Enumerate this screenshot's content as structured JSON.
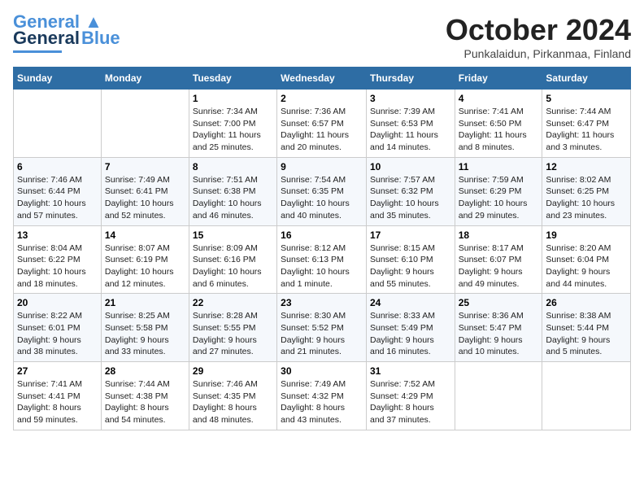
{
  "header": {
    "logo_main": "General",
    "logo_accent": "Blue",
    "month_title": "October 2024",
    "subtitle": "Punkalaidun, Pirkanmaa, Finland"
  },
  "weekdays": [
    "Sunday",
    "Monday",
    "Tuesday",
    "Wednesday",
    "Thursday",
    "Friday",
    "Saturday"
  ],
  "weeks": [
    [
      {
        "day": "",
        "info": ""
      },
      {
        "day": "",
        "info": ""
      },
      {
        "day": "1",
        "info": "Sunrise: 7:34 AM\nSunset: 7:00 PM\nDaylight: 11 hours\nand 25 minutes."
      },
      {
        "day": "2",
        "info": "Sunrise: 7:36 AM\nSunset: 6:57 PM\nDaylight: 11 hours\nand 20 minutes."
      },
      {
        "day": "3",
        "info": "Sunrise: 7:39 AM\nSunset: 6:53 PM\nDaylight: 11 hours\nand 14 minutes."
      },
      {
        "day": "4",
        "info": "Sunrise: 7:41 AM\nSunset: 6:50 PM\nDaylight: 11 hours\nand 8 minutes."
      },
      {
        "day": "5",
        "info": "Sunrise: 7:44 AM\nSunset: 6:47 PM\nDaylight: 11 hours\nand 3 minutes."
      }
    ],
    [
      {
        "day": "6",
        "info": "Sunrise: 7:46 AM\nSunset: 6:44 PM\nDaylight: 10 hours\nand 57 minutes."
      },
      {
        "day": "7",
        "info": "Sunrise: 7:49 AM\nSunset: 6:41 PM\nDaylight: 10 hours\nand 52 minutes."
      },
      {
        "day": "8",
        "info": "Sunrise: 7:51 AM\nSunset: 6:38 PM\nDaylight: 10 hours\nand 46 minutes."
      },
      {
        "day": "9",
        "info": "Sunrise: 7:54 AM\nSunset: 6:35 PM\nDaylight: 10 hours\nand 40 minutes."
      },
      {
        "day": "10",
        "info": "Sunrise: 7:57 AM\nSunset: 6:32 PM\nDaylight: 10 hours\nand 35 minutes."
      },
      {
        "day": "11",
        "info": "Sunrise: 7:59 AM\nSunset: 6:29 PM\nDaylight: 10 hours\nand 29 minutes."
      },
      {
        "day": "12",
        "info": "Sunrise: 8:02 AM\nSunset: 6:25 PM\nDaylight: 10 hours\nand 23 minutes."
      }
    ],
    [
      {
        "day": "13",
        "info": "Sunrise: 8:04 AM\nSunset: 6:22 PM\nDaylight: 10 hours\nand 18 minutes."
      },
      {
        "day": "14",
        "info": "Sunrise: 8:07 AM\nSunset: 6:19 PM\nDaylight: 10 hours\nand 12 minutes."
      },
      {
        "day": "15",
        "info": "Sunrise: 8:09 AM\nSunset: 6:16 PM\nDaylight: 10 hours\nand 6 minutes."
      },
      {
        "day": "16",
        "info": "Sunrise: 8:12 AM\nSunset: 6:13 PM\nDaylight: 10 hours\nand 1 minute."
      },
      {
        "day": "17",
        "info": "Sunrise: 8:15 AM\nSunset: 6:10 PM\nDaylight: 9 hours\nand 55 minutes."
      },
      {
        "day": "18",
        "info": "Sunrise: 8:17 AM\nSunset: 6:07 PM\nDaylight: 9 hours\nand 49 minutes."
      },
      {
        "day": "19",
        "info": "Sunrise: 8:20 AM\nSunset: 6:04 PM\nDaylight: 9 hours\nand 44 minutes."
      }
    ],
    [
      {
        "day": "20",
        "info": "Sunrise: 8:22 AM\nSunset: 6:01 PM\nDaylight: 9 hours\nand 38 minutes."
      },
      {
        "day": "21",
        "info": "Sunrise: 8:25 AM\nSunset: 5:58 PM\nDaylight: 9 hours\nand 33 minutes."
      },
      {
        "day": "22",
        "info": "Sunrise: 8:28 AM\nSunset: 5:55 PM\nDaylight: 9 hours\nand 27 minutes."
      },
      {
        "day": "23",
        "info": "Sunrise: 8:30 AM\nSunset: 5:52 PM\nDaylight: 9 hours\nand 21 minutes."
      },
      {
        "day": "24",
        "info": "Sunrise: 8:33 AM\nSunset: 5:49 PM\nDaylight: 9 hours\nand 16 minutes."
      },
      {
        "day": "25",
        "info": "Sunrise: 8:36 AM\nSunset: 5:47 PM\nDaylight: 9 hours\nand 10 minutes."
      },
      {
        "day": "26",
        "info": "Sunrise: 8:38 AM\nSunset: 5:44 PM\nDaylight: 9 hours\nand 5 minutes."
      }
    ],
    [
      {
        "day": "27",
        "info": "Sunrise: 7:41 AM\nSunset: 4:41 PM\nDaylight: 8 hours\nand 59 minutes."
      },
      {
        "day": "28",
        "info": "Sunrise: 7:44 AM\nSunset: 4:38 PM\nDaylight: 8 hours\nand 54 minutes."
      },
      {
        "day": "29",
        "info": "Sunrise: 7:46 AM\nSunset: 4:35 PM\nDaylight: 8 hours\nand 48 minutes."
      },
      {
        "day": "30",
        "info": "Sunrise: 7:49 AM\nSunset: 4:32 PM\nDaylight: 8 hours\nand 43 minutes."
      },
      {
        "day": "31",
        "info": "Sunrise: 7:52 AM\nSunset: 4:29 PM\nDaylight: 8 hours\nand 37 minutes."
      },
      {
        "day": "",
        "info": ""
      },
      {
        "day": "",
        "info": ""
      }
    ]
  ]
}
